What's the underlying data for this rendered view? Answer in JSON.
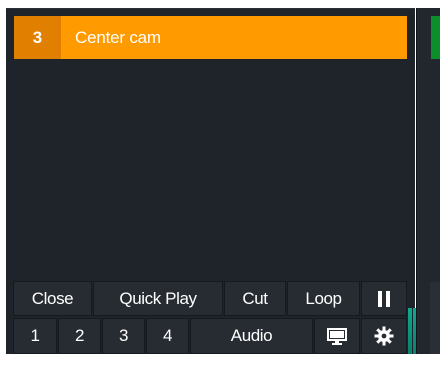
{
  "clip": {
    "number": "3",
    "title": "Center cam"
  },
  "controls": {
    "row1": [
      "Close",
      "Quick Play",
      "Cut",
      "Loop"
    ],
    "pause_icon": "pause-icon",
    "row2_numbers": [
      "1",
      "2",
      "3",
      "4"
    ],
    "audio_label": "Audio",
    "monitor_icon": "monitor-icon",
    "settings_icon": "gear-icon"
  },
  "colors": {
    "accent": "#ff9a00",
    "panel": "#1f232a",
    "meter": "#0fa990"
  }
}
